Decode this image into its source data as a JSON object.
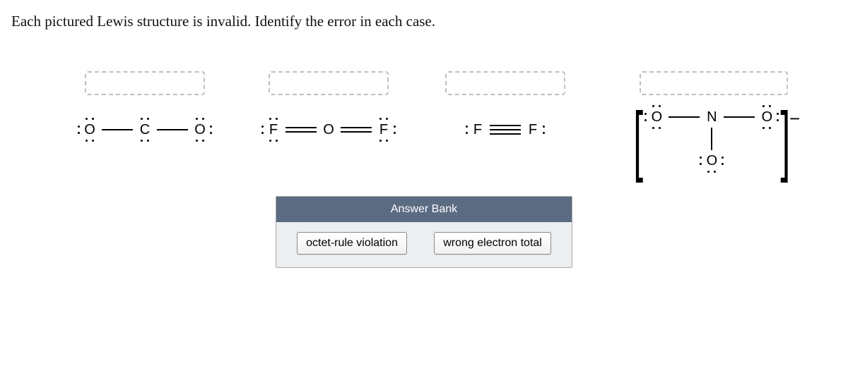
{
  "prompt": "Each pictured Lewis structure is invalid. Identify the error in each case.",
  "answer_bank": {
    "header": "Answer Bank",
    "chips": [
      "octet-rule violation",
      "wrong electron total"
    ]
  },
  "structures": [
    {
      "id": "CO2-like",
      "atoms": [
        {
          "symbol": "O",
          "lone_pairs": [
            "left",
            "top",
            "bottom"
          ]
        },
        {
          "symbol": "C",
          "lone_pairs": [
            "top",
            "bottom"
          ]
        },
        {
          "symbol": "O",
          "lone_pairs": [
            "top",
            "right",
            "bottom"
          ]
        }
      ],
      "bonds": [
        {
          "from": 0,
          "to": 1,
          "order": 1
        },
        {
          "from": 1,
          "to": 2,
          "order": 1
        }
      ]
    },
    {
      "id": "OF2-like",
      "atoms": [
        {
          "symbol": "F",
          "lone_pairs": [
            "left",
            "top",
            "bottom"
          ]
        },
        {
          "symbol": "O",
          "lone_pairs": []
        },
        {
          "symbol": "F",
          "lone_pairs": [
            "top",
            "right",
            "bottom"
          ]
        }
      ],
      "bonds": [
        {
          "from": 0,
          "to": 1,
          "order": 2
        },
        {
          "from": 1,
          "to": 2,
          "order": 2
        }
      ]
    },
    {
      "id": "F2-triple",
      "atoms": [
        {
          "symbol": "F",
          "lone_pairs": [
            "left"
          ]
        },
        {
          "symbol": "F",
          "lone_pairs": [
            "right"
          ]
        }
      ],
      "bonds": [
        {
          "from": 0,
          "to": 1,
          "order": 3
        }
      ]
    },
    {
      "id": "NO3-",
      "charge": "−",
      "atoms": [
        {
          "symbol": "O",
          "position": "top-left",
          "lone_pairs": [
            "left",
            "top",
            "bottom"
          ]
        },
        {
          "symbol": "N",
          "position": "center",
          "lone_pairs": []
        },
        {
          "symbol": "O",
          "position": "top-right",
          "lone_pairs": [
            "top",
            "right",
            "bottom"
          ]
        },
        {
          "symbol": "O",
          "position": "bottom",
          "lone_pairs": [
            "left",
            "right",
            "bottom"
          ]
        }
      ],
      "bonds": [
        {
          "from": 0,
          "to": 1,
          "order": 1
        },
        {
          "from": 1,
          "to": 2,
          "order": 1
        },
        {
          "from": 1,
          "to": 3,
          "order": 1,
          "dir": "vertical"
        }
      ]
    }
  ]
}
